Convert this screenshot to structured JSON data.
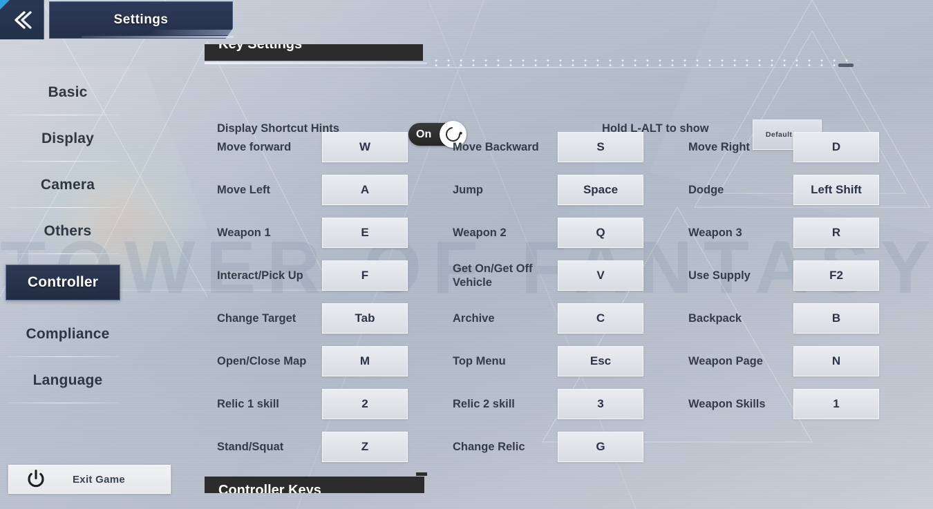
{
  "window": {
    "title": "Settings",
    "back_icon": "chevron-double-left-icon",
    "background_watermark": "TOWER OF FANTASY"
  },
  "sidebar": {
    "items": [
      {
        "label": "Basic",
        "active": false
      },
      {
        "label": "Display",
        "active": false
      },
      {
        "label": "Camera",
        "active": false
      },
      {
        "label": "Others",
        "active": false
      },
      {
        "label": "Controller",
        "active": true
      },
      {
        "label": "Compliance",
        "active": false
      },
      {
        "label": "Language",
        "active": false
      }
    ]
  },
  "content": {
    "top_section_title": "Key Settings",
    "bottom_section_title": "Controller Keys",
    "options": {
      "shortcut_hints_label": "Display Shortcut Hints",
      "shortcut_hints_state": "On",
      "cursor_hint_label": "Hold L-ALT to show cursor",
      "default_key_label": "Default Key"
    },
    "keybind_rows": [
      [
        {
          "action": "Move forward",
          "key": "W"
        },
        {
          "action": "Move Backward",
          "key": "S"
        },
        {
          "action": "Move Right",
          "key": "D"
        }
      ],
      [
        {
          "action": "Move Left",
          "key": "A"
        },
        {
          "action": "Jump",
          "key": "Space"
        },
        {
          "action": "Dodge",
          "key": "Left Shift"
        }
      ],
      [
        {
          "action": "Weapon 1",
          "key": "E"
        },
        {
          "action": "Weapon 2",
          "key": "Q"
        },
        {
          "action": "Weapon 3",
          "key": "R"
        }
      ],
      [
        {
          "action": "Interact/Pick Up",
          "key": "F"
        },
        {
          "action": "Get On/Get Off Vehicle",
          "key": "V"
        },
        {
          "action": "Use Supply",
          "key": "F2"
        }
      ],
      [
        {
          "action": "Change Target",
          "key": "Tab"
        },
        {
          "action": "Archive",
          "key": "C"
        },
        {
          "action": "Backpack",
          "key": "B"
        }
      ],
      [
        {
          "action": "Open/Close Map",
          "key": "M"
        },
        {
          "action": "Top Menu",
          "key": "Esc"
        },
        {
          "action": "Weapon Page",
          "key": "N"
        }
      ],
      [
        {
          "action": "Relic 1 skill",
          "key": "2"
        },
        {
          "action": "Relic 2 skill",
          "key": "3"
        },
        {
          "action": "Weapon Skills",
          "key": "1"
        }
      ],
      [
        {
          "action": "Stand/Squat",
          "key": "Z"
        },
        {
          "action": "Change Relic",
          "key": "G"
        },
        {
          "action": "",
          "key": ""
        }
      ]
    ]
  },
  "footer": {
    "exit_game_label": "Exit Game",
    "exit_game_icon": "power-icon"
  },
  "colors": {
    "accent_navy": "#2d3a58",
    "accent_cyan": "#2f9fe0",
    "key_box": "#e4e6ea",
    "key_text": "#2b3347",
    "label_text": "#343c48",
    "section_bar": "#2c2c2c",
    "page_bg": "#b5bcca"
  }
}
